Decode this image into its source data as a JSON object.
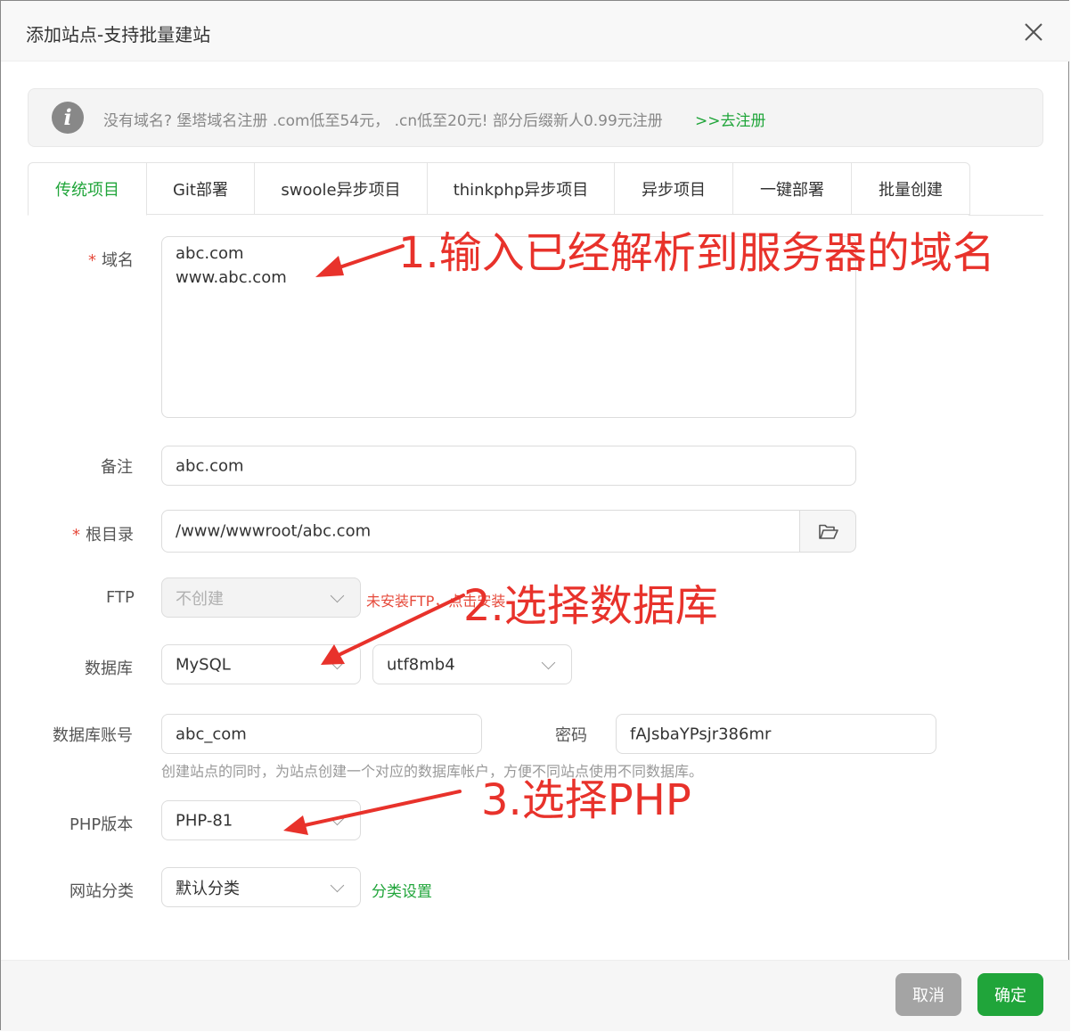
{
  "window": {
    "title": "添加站点-支持批量建站"
  },
  "notice": {
    "text": "没有域名? 堡塔域名注册 .com低至54元，  .cn低至20元! 部分后缀新人0.99元注册",
    "link": ">>去注册"
  },
  "tabs": [
    {
      "label": "传统项目",
      "active": true
    },
    {
      "label": "Git部署",
      "active": false
    },
    {
      "label": "swoole异步项目",
      "active": false
    },
    {
      "label": "thinkphp异步项目",
      "active": false
    },
    {
      "label": "异步项目",
      "active": false
    },
    {
      "label": "一键部署",
      "active": false
    },
    {
      "label": "批量创建",
      "active": false
    }
  ],
  "form": {
    "domain": {
      "label": "域名",
      "required_mark": "*",
      "lines": [
        "abc.com",
        "www.abc.com"
      ]
    },
    "remark": {
      "label": "备注",
      "value": "abc.com"
    },
    "root": {
      "label": "根目录",
      "required_mark": "*",
      "value": "/www/wwwroot/abc.com"
    },
    "ftp": {
      "label": "FTP",
      "value": "不创建",
      "warning": "未安装FTP，点击安装"
    },
    "database": {
      "label": "数据库",
      "type": "MySQL",
      "charset": "utf8mb4"
    },
    "db_account": {
      "label": "数据库账号",
      "value": "abc_com",
      "password_label": "密码",
      "password": "fAJsbaYPsjr386mr",
      "hint": "创建站点的同时，为站点创建一个对应的数据库帐户，方便不同站点使用不同数据库。"
    },
    "php": {
      "label": "PHP版本",
      "value": "PHP-81"
    },
    "category": {
      "label": "网站分类",
      "value": "默认分类",
      "link": "分类设置"
    }
  },
  "footer": {
    "cancel": "取消",
    "confirm": "确定"
  },
  "annotations": {
    "step1": "1.输入已经解析到服务器的域名",
    "step2": "2.选择数据库",
    "step3": "3.选择PHP"
  },
  "colors": {
    "accent": "#20a53a",
    "annotation": "#e8322b",
    "required": "#e64a3b"
  }
}
